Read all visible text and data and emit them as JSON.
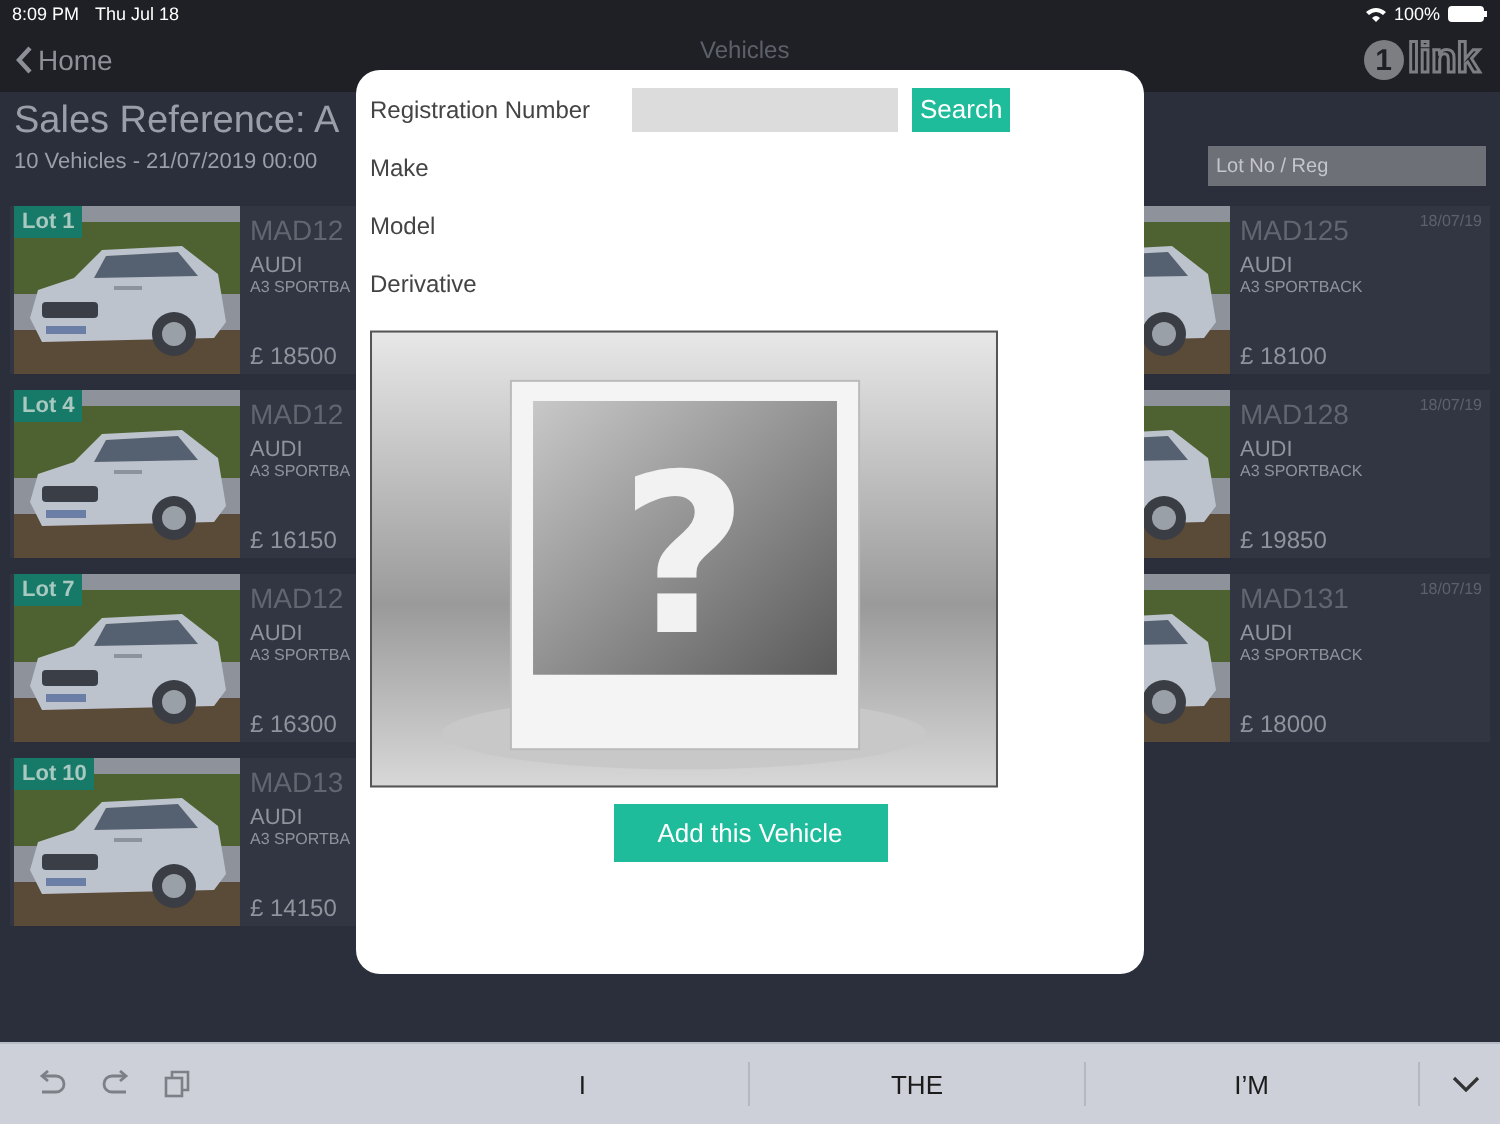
{
  "status_bar": {
    "time": "8:09 PM",
    "date": "Thu Jul 18",
    "battery": "100%"
  },
  "nav": {
    "back": "Home",
    "title": "Vehicles",
    "logo_mark": "1",
    "logo_text": "link"
  },
  "header": {
    "title": "Sales Reference: A",
    "subtitle": "10 Vehicles - 21/07/2019 00:00",
    "search": {
      "placeholder": "Lot No / Reg"
    }
  },
  "vehicles_left": [
    {
      "lot": "Lot 1",
      "reg": "MAD12",
      "make": "AUDI",
      "model": "A3 SPORTBA",
      "price": "£ 18500"
    },
    {
      "lot": "Lot 4",
      "reg": "MAD12",
      "make": "AUDI",
      "model": "A3 SPORTBA",
      "price": "£ 16150"
    },
    {
      "lot": "Lot 7",
      "reg": "MAD12",
      "make": "AUDI",
      "model": "A3 SPORTBA",
      "price": "£ 16300"
    },
    {
      "lot": "Lot 10",
      "reg": "MAD13",
      "make": "AUDI",
      "model": "A3 SPORTBA",
      "price": "£ 14150"
    }
  ],
  "vehicles_right": [
    {
      "reg": "MAD125",
      "date": "18/07/19",
      "make": "AUDI",
      "model": "A3 SPORTBACK",
      "price": "£ 18100"
    },
    {
      "reg": "MAD128",
      "date": "18/07/19",
      "make": "AUDI",
      "model": "A3 SPORTBACK",
      "price": "£ 19850"
    },
    {
      "reg": "MAD131",
      "date": "18/07/19",
      "make": "AUDI",
      "model": "A3 SPORTBACK",
      "price": "£ 18000"
    }
  ],
  "dialog": {
    "fields": [
      {
        "label": "Registration Number",
        "kind": "input"
      },
      {
        "label": "Make",
        "kind": "text"
      },
      {
        "label": "Model",
        "kind": "text"
      },
      {
        "label": "Derivative",
        "kind": "text"
      }
    ],
    "search_button": "Search",
    "placeholder_mark": "?",
    "add_button": "Add this Vehicle"
  },
  "keyboard": {
    "suggestions": [
      "I",
      "THE",
      "I’M"
    ]
  }
}
